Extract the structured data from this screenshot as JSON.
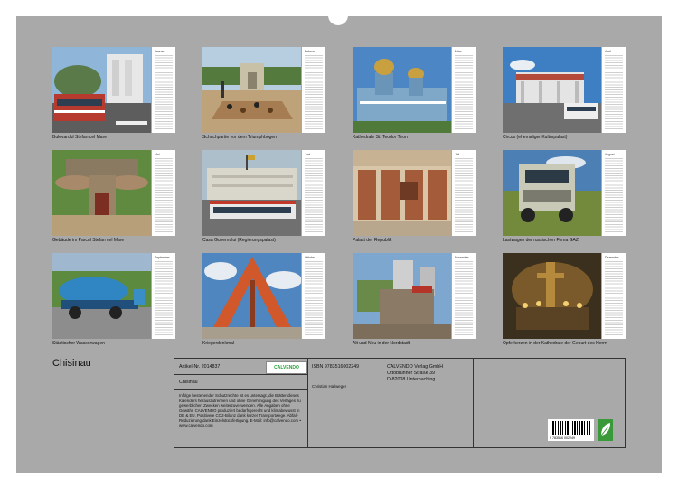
{
  "document": {
    "title": "Chisinau"
  },
  "months": [
    {
      "month": "Januar",
      "caption": "Bulevardul Stefan cel Mare"
    },
    {
      "month": "Februar",
      "caption": "Schachpartie vor dem Triumphbogen"
    },
    {
      "month": "März",
      "caption": "Kathedrale St. Teodor Tiron"
    },
    {
      "month": "April",
      "caption": "Circus (ehemaliger Kulturpalast)"
    },
    {
      "month": "Mai",
      "caption": "Gebäude im Parcul Stefan cel Mare"
    },
    {
      "month": "Juni",
      "caption": "Casa Guvernului (Regierungspalast)"
    },
    {
      "month": "Juli",
      "caption": "Palast der Republik"
    },
    {
      "month": "August",
      "caption": "Lastwagen der russischen Firma GAZ"
    },
    {
      "month": "September",
      "caption": "Städtischer Wasserwagen"
    },
    {
      "month": "Oktober",
      "caption": "Kriegerdenkmal"
    },
    {
      "month": "November",
      "caption": "Alt und Neu in der Nordstadt"
    },
    {
      "month": "Dezember",
      "caption": "Opferkerzen in der Kathedrale der Geburt des Herrn"
    }
  ],
  "info": {
    "article_no": "Artikel-Nr. 2014837",
    "logo_text": "CALVENDO",
    "name": "Chisinau",
    "legal_text": "Infolge bestehender Schutzrechte ist es untersagt, die Blätter dieses Kalenders herauszutrennen und ohne Genehmigung des Verlages zu gewerblichen Zwecken weiterzuverwenden. Alle Angaben ohne Gewähr. CALVENDO produziert bedarfsgerecht und klimabewusst in DE & EU. Positivere CO2-Bilanz dank kurzer Transportwege. Abfall-Reduzierung dank Einzelstückfertigung. E-Mail: info@calvendo.com • www.calvendo.com",
    "isbn": "ISBN 9783516002249",
    "author": "Christian Hallweger",
    "publisher_1": "CALVENDO Verlag GmbH",
    "publisher_2": "Ottobrunner Straße 39",
    "publisher_3": "D-82008 Unterhaching",
    "barcode_number": "9 783516 002249"
  }
}
